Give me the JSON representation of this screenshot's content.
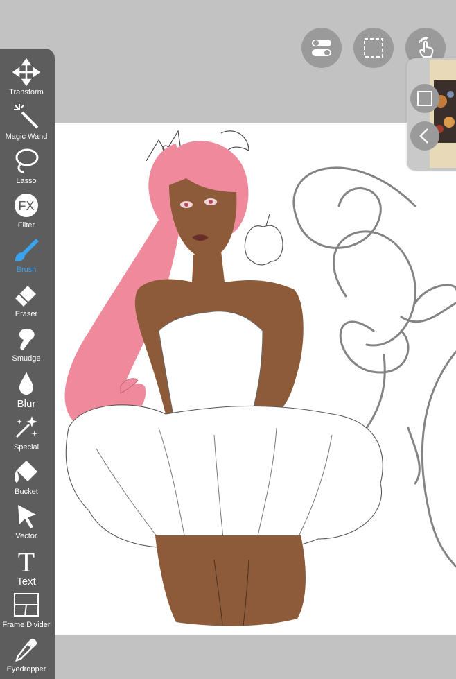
{
  "tools": [
    {
      "id": "transform",
      "label": "Transform",
      "icon": "move-arrows-icon"
    },
    {
      "id": "magic-wand",
      "label": "Magic Wand",
      "icon": "magic-wand-icon"
    },
    {
      "id": "lasso",
      "label": "Lasso",
      "icon": "lasso-icon"
    },
    {
      "id": "filter",
      "label": "Filter",
      "icon": "fx-icon",
      "icon_text": "FX"
    },
    {
      "id": "brush",
      "label": "Brush",
      "icon": "brush-icon",
      "active": true
    },
    {
      "id": "eraser",
      "label": "Eraser",
      "icon": "eraser-icon"
    },
    {
      "id": "smudge",
      "label": "Smudge",
      "icon": "smudge-finger-icon"
    },
    {
      "id": "blur",
      "label": "Blur",
      "icon": "droplet-icon"
    },
    {
      "id": "special",
      "label": "Special",
      "icon": "sparkle-icon"
    },
    {
      "id": "bucket",
      "label": "Bucket",
      "icon": "paint-bucket-icon"
    },
    {
      "id": "vector",
      "label": "Vector",
      "icon": "cursor-arrow-icon"
    },
    {
      "id": "text",
      "label": "Text",
      "icon": "text-t-icon",
      "icon_text": "T"
    },
    {
      "id": "frame-divider",
      "label": "Frame Divider",
      "icon": "frame-divider-icon"
    },
    {
      "id": "eyedropper",
      "label": "Eyedropper",
      "icon": "eyedropper-icon"
    }
  ],
  "top_buttons": [
    {
      "id": "toggle",
      "icon": "toggle-switch-icon"
    },
    {
      "id": "selection",
      "icon": "dashed-selection-icon"
    },
    {
      "id": "gesture",
      "icon": "hand-touch-icon"
    }
  ],
  "navigator": {
    "buttons": [
      {
        "id": "frame",
        "icon": "square-frame-icon"
      },
      {
        "id": "collapse",
        "icon": "chevron-left-icon"
      }
    ]
  },
  "colors": {
    "toolbar": "#5d5d5d",
    "active": "#3aa3f0",
    "background": "#c2c2c2",
    "canvas": "#ffffff",
    "hair": "#ee8a9c",
    "skin": "#8e5b3a"
  }
}
